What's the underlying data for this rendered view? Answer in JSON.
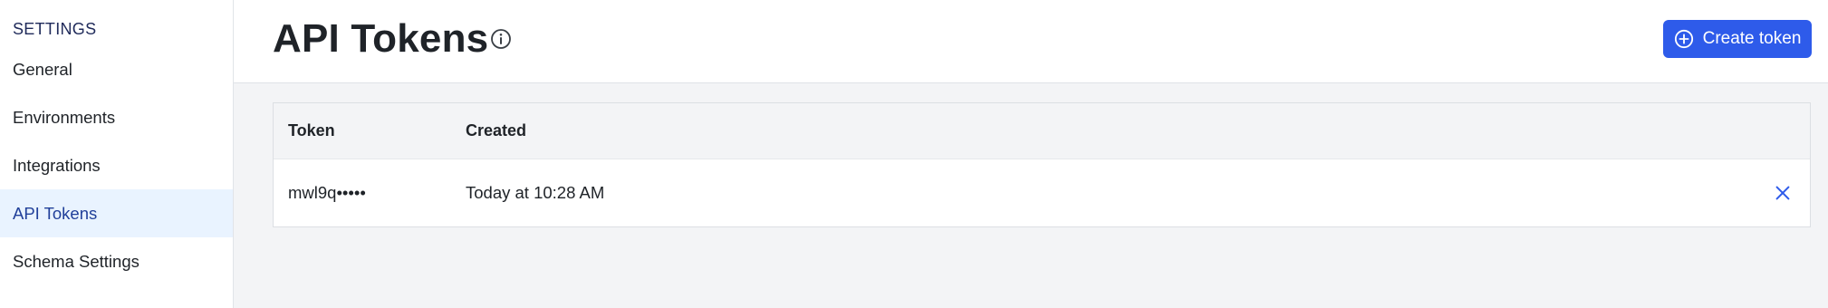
{
  "sidebar": {
    "heading": "SETTINGS",
    "items": [
      {
        "label": "General",
        "active": false
      },
      {
        "label": "Environments",
        "active": false
      },
      {
        "label": "Integrations",
        "active": false
      },
      {
        "label": "API Tokens",
        "active": true
      },
      {
        "label": "Schema Settings",
        "active": false
      }
    ]
  },
  "header": {
    "title": "API Tokens",
    "info_icon": "info-circle-icon",
    "create_button_label": "Create token",
    "create_button_icon": "plus-circle-icon"
  },
  "table": {
    "columns": [
      "Token",
      "Created",
      ""
    ],
    "rows": [
      {
        "token": "mwl9q•••••",
        "created": "Today at 10:28 AM",
        "action_icon": "close-icon"
      }
    ]
  },
  "colors": {
    "accent": "#2e5bea",
    "sidebar_active_bg": "#e9f3ff",
    "sidebar_active_text": "#21409a",
    "page_bg": "#f3f4f6"
  }
}
